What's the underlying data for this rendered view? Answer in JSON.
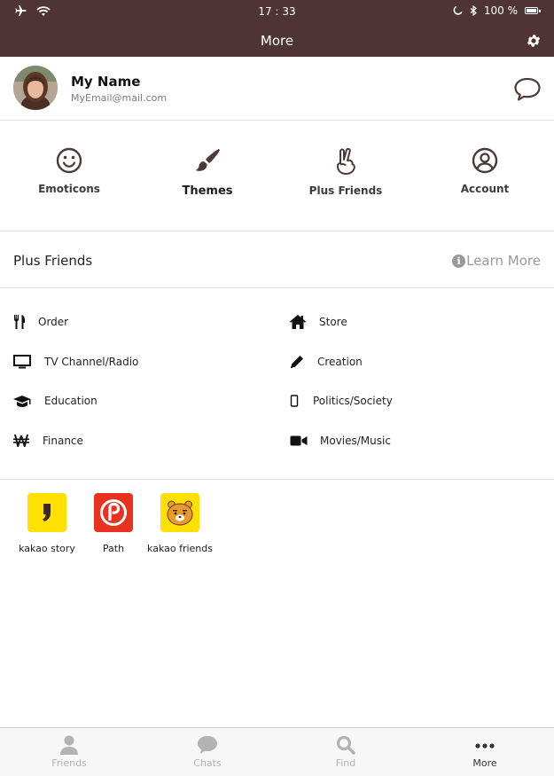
{
  "status_bar": {
    "time": "17 : 33",
    "battery": "100 %"
  },
  "nav": {
    "title": "More"
  },
  "profile": {
    "name": "My Name",
    "email": "MyEmail@mail.com"
  },
  "quick_menu": [
    {
      "label": "Emoticons",
      "icon": "smiley-icon"
    },
    {
      "label": "Themes",
      "icon": "paintbrush-icon"
    },
    {
      "label": "Plus Friends",
      "icon": "peace-hand-icon"
    },
    {
      "label": "Account",
      "icon": "user-circle-icon"
    }
  ],
  "plus_friends": {
    "title": "Plus Friends",
    "learn_more": "Learn More",
    "categories": [
      {
        "label": "Order",
        "icon": "utensils-icon"
      },
      {
        "label": "Store",
        "icon": "home-icon"
      },
      {
        "label": "TV Channel/Radio",
        "icon": "monitor-icon"
      },
      {
        "label": "Creation",
        "icon": "pencil-icon"
      },
      {
        "label": "Education",
        "icon": "graduation-cap-icon"
      },
      {
        "label": "Politics/Society",
        "icon": "mobile-icon"
      },
      {
        "label": "Finance",
        "icon": "won-icon"
      },
      {
        "label": "Movies/Music",
        "icon": "video-camera-icon"
      }
    ]
  },
  "apps": [
    {
      "label": "kakao story",
      "icon": "kakao-story-icon",
      "color": "#ffe000"
    },
    {
      "label": "Path",
      "icon": "path-icon",
      "color": "#e8321f"
    },
    {
      "label": "kakao friends",
      "icon": "kakao-friends-icon",
      "color": "#ffe000"
    }
  ],
  "tabs": [
    {
      "label": "Friends",
      "icon": "person-icon"
    },
    {
      "label": "Chats",
      "icon": "chat-icon"
    },
    {
      "label": "Find",
      "icon": "search-icon"
    },
    {
      "label": "More",
      "icon": "more-dots-icon",
      "active": true
    }
  ],
  "colors": {
    "header_bg": "#4f3434",
    "divider": "#e3e3e3",
    "tab_inactive": "#b3b3b3"
  }
}
